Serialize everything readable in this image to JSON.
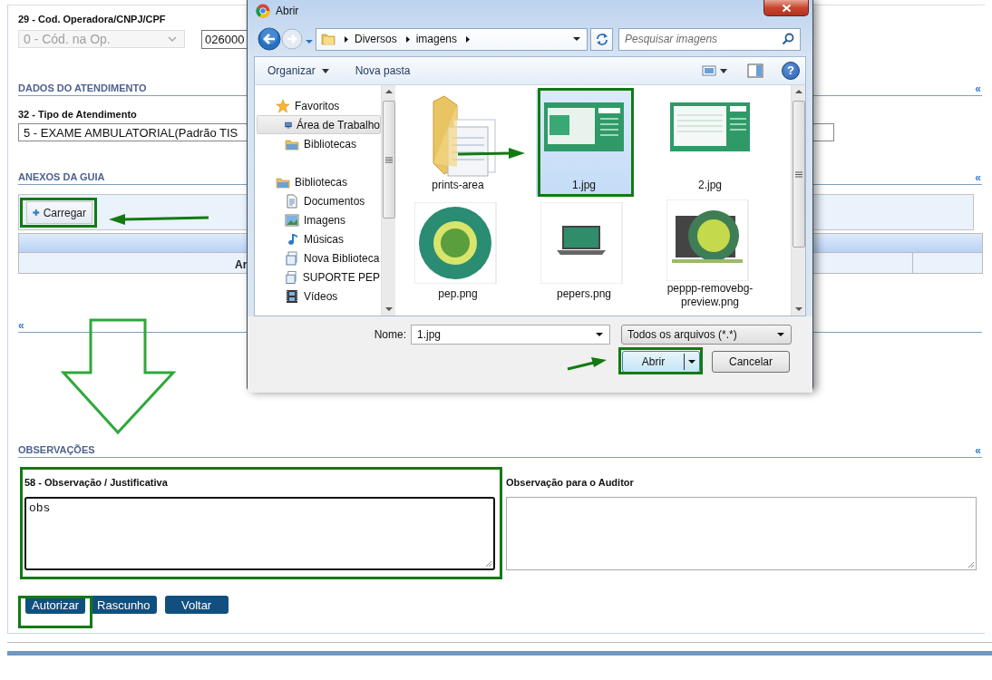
{
  "form": {
    "operator": {
      "label": "29 - Cod. Operadora/CNPJ/CPF",
      "select_value": "0 - Cód. na Op.",
      "select_disabled": true,
      "code_value": "026000"
    },
    "attendance": {
      "title": "DADOS DO ATENDIMENTO",
      "collapse": "«",
      "field_label": "32 - Tipo de Atendimento",
      "select_value": "5 - EXAME AMBULATORIAL(Padrão TIS"
    },
    "attachments": {
      "title": "ANEXOS DA GUIA",
      "collapse": "«",
      "upload_button": "Carregar",
      "table_column": "Ar"
    },
    "covered_section": {
      "collapse": "«"
    },
    "observations": {
      "title": "OBSERVAÇÕES",
      "collapse": "«",
      "fields": [
        {
          "label": "58 - Observação / Justificativa",
          "value": "obs",
          "focused": true
        },
        {
          "label": "Observação para o Auditor",
          "focused": false
        }
      ]
    },
    "buttons": [
      "Autorizar",
      "Rascunho",
      "Voltar"
    ]
  },
  "dialog": {
    "title": "Abrir",
    "path": [
      "Diversos",
      "imagens"
    ],
    "search_placeholder": "Pesquisar imagens",
    "toolbar": [
      {
        "label": "Organizar",
        "dropdown": true
      },
      {
        "label": "Nova pasta",
        "dropdown": false
      }
    ],
    "nav": [
      {
        "label": "Favoritos",
        "selected": false,
        "children": [
          {
            "label": "Área de Trabalho",
            "selected": true
          },
          {
            "label": "Bibliotecas",
            "selected": false
          }
        ]
      },
      {
        "label": "Bibliotecas",
        "selected": false,
        "children": [
          {
            "label": "Documentos",
            "selected": false
          },
          {
            "label": "Imagens",
            "selected": false
          },
          {
            "label": "Músicas",
            "selected": false
          },
          {
            "label": "Nova Biblioteca",
            "selected": false
          },
          {
            "label": "SUPORTE PEP",
            "selected": false
          },
          {
            "label": "Vídeos",
            "selected": false
          }
        ]
      }
    ],
    "files": [
      {
        "name": "prints-area",
        "kind": "folder",
        "selected": false
      },
      {
        "name": "1.jpg",
        "kind": "image",
        "selected": true
      },
      {
        "name": "2.jpg",
        "kind": "image",
        "selected": false
      },
      {
        "name": "pep.png",
        "kind": "image",
        "selected": false
      },
      {
        "name": "pepers.png",
        "kind": "image",
        "selected": false
      },
      {
        "name": "peppp-removebg-preview.png",
        "kind": "image",
        "selected": false
      }
    ],
    "help_button": "?",
    "filename_label": "Nome:",
    "filename": "1.jpg",
    "filetype": "Todos os arquivos (*.*)",
    "open_button": "Abrir",
    "cancel_button": "Cancelar"
  }
}
